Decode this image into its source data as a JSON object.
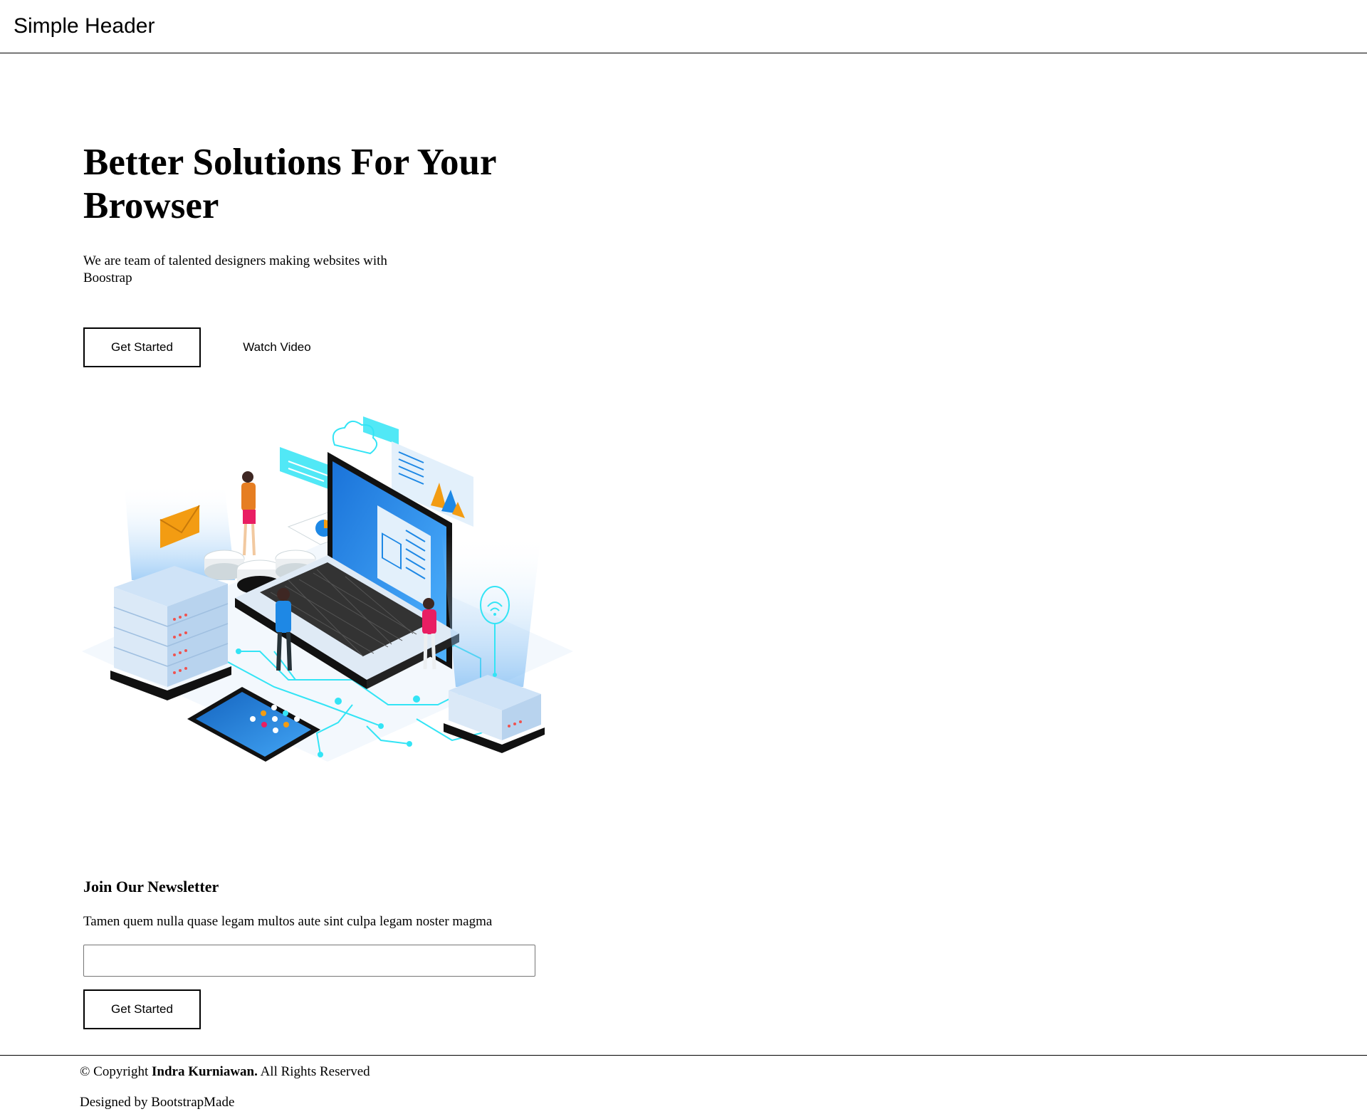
{
  "header": {
    "brand": "Simple Header"
  },
  "hero": {
    "title": "Better Solutions For Your Browser",
    "subtitle": "We are team of talented designers making websites with Boostrap",
    "primary_button": "Get Started",
    "secondary_button": "Watch Video",
    "illustration_icon": "laptop-network-illustration"
  },
  "newsletter": {
    "title": "Join Our Newsletter",
    "text": "Tamen quem nulla quase legam multos aute sint culpa legam noster magma",
    "email_value": "",
    "email_placeholder": "",
    "button": "Get Started"
  },
  "footer": {
    "copyright_prefix": "© Copyright ",
    "copyright_owner": "Indra Kurniawan.",
    "copyright_suffix": " All Rights Reserved",
    "credit": "Designed by BootstrapMade"
  },
  "colors": {
    "text": "#000000",
    "background": "#ffffff",
    "illustration_blue": "#1e88e5",
    "illustration_cyan": "#33e4f5",
    "illustration_orange": "#f39c12"
  }
}
